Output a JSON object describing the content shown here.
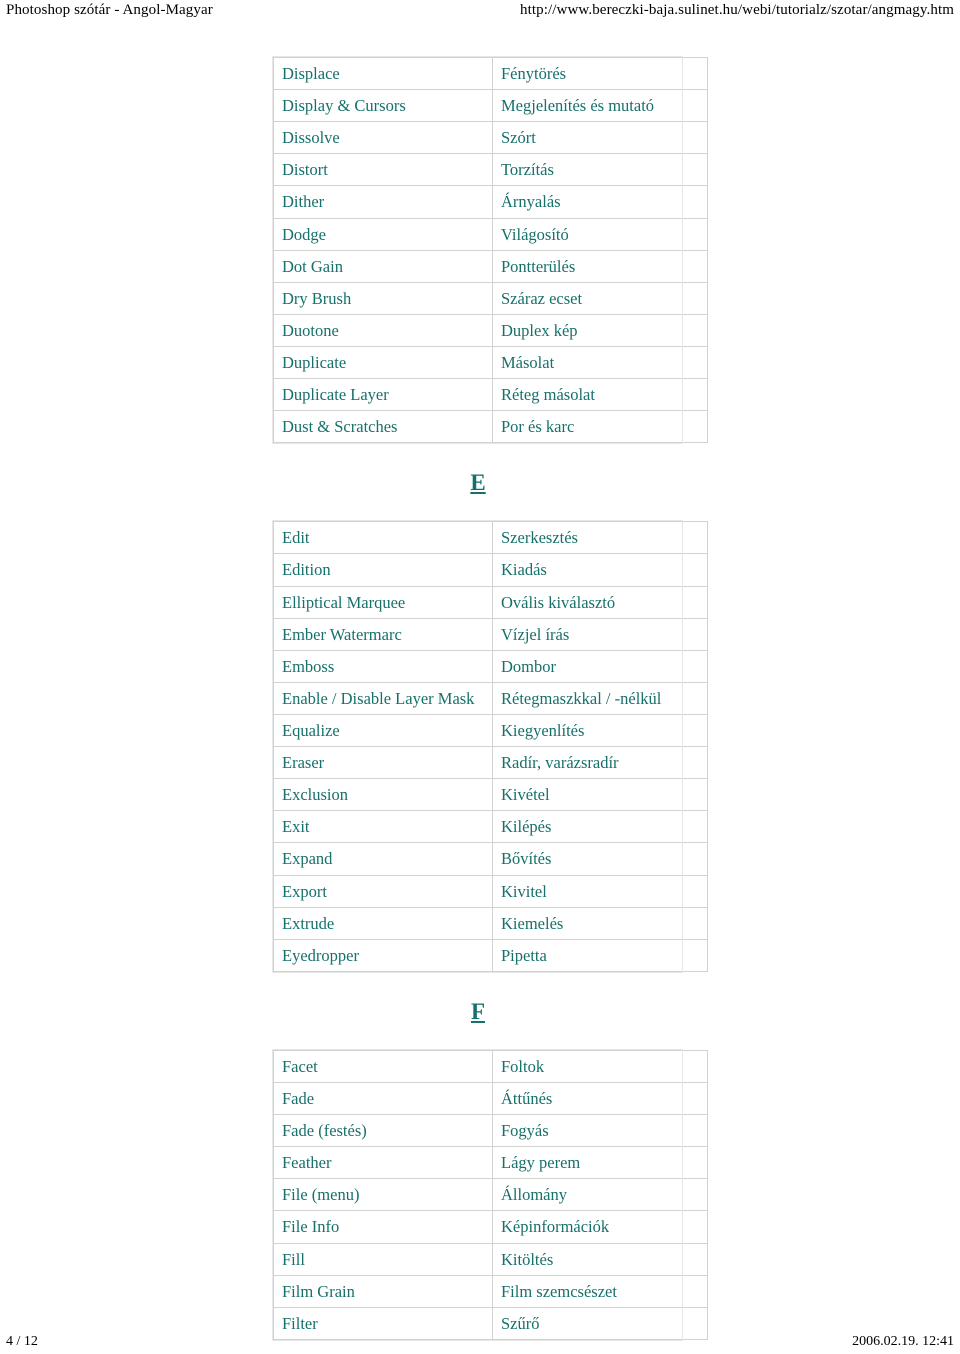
{
  "header": {
    "title": "Photoshop szótár - Angol-Magyar",
    "url": "http://www.bereczki-baja.sulinet.hu/webi/tutorialz/szotar/angmagy.htm"
  },
  "footer": {
    "page_number": "4 / 12",
    "timestamp": "2006.02.19. 12:41"
  },
  "colors": {
    "text_teal": "#16706b",
    "border_gray": "#d2d2d2",
    "page_background": "#ffffff",
    "header_text": "#000000"
  },
  "sections": [
    {
      "letter": "",
      "rows": [
        {
          "en": "Displace",
          "hu": "Fénytörés"
        },
        {
          "en": "Display & Cursors",
          "hu": "Megjelenítés és mutató"
        },
        {
          "en": "Dissolve",
          "hu": "Szórt"
        },
        {
          "en": "Distort",
          "hu": "Torzítás"
        },
        {
          "en": "Dither",
          "hu": "Árnyalás"
        },
        {
          "en": "Dodge",
          "hu": "Világosító"
        },
        {
          "en": "Dot Gain",
          "hu": "Pontterülés"
        },
        {
          "en": "Dry Brush",
          "hu": "Száraz ecset"
        },
        {
          "en": "Duotone",
          "hu": "Duplex kép"
        },
        {
          "en": "Duplicate",
          "hu": "Másolat"
        },
        {
          "en": "Duplicate Layer",
          "hu": "Réteg másolat"
        },
        {
          "en": "Dust & Scratches",
          "hu": "Por és karc"
        }
      ]
    },
    {
      "letter": "E",
      "rows": [
        {
          "en": "Edit",
          "hu": "Szerkesztés"
        },
        {
          "en": "Edition",
          "hu": "Kiadás"
        },
        {
          "en": "Elliptical Marquee",
          "hu": "Ovális kiválasztó"
        },
        {
          "en": "Ember Watermarc",
          "hu": "Vízjel írás"
        },
        {
          "en": "Emboss",
          "hu": "Dombor"
        },
        {
          "en": "Enable / Disable Layer Mask",
          "hu": "Rétegmaszkkal / -nélkül"
        },
        {
          "en": "Equalize",
          "hu": "Kiegyenlítés"
        },
        {
          "en": "Eraser",
          "hu": "Radír, varázsradír"
        },
        {
          "en": "Exclusion",
          "hu": "Kivétel"
        },
        {
          "en": "Exit",
          "hu": "Kilépés"
        },
        {
          "en": "Expand",
          "hu": "Bővítés"
        },
        {
          "en": "Export",
          "hu": "Kivitel"
        },
        {
          "en": "Extrude",
          "hu": "Kiemelés"
        },
        {
          "en": "Eyedropper",
          "hu": "Pipetta"
        }
      ]
    },
    {
      "letter": "F",
      "rows": [
        {
          "en": "Facet",
          "hu": "Foltok"
        },
        {
          "en": "Fade",
          "hu": "Áttűnés"
        },
        {
          "en": "Fade (festés)",
          "hu": "Fogyás"
        },
        {
          "en": "Feather",
          "hu": "Lágy perem"
        },
        {
          "en": "File (menu)",
          "hu": "Állomány"
        },
        {
          "en": "File Info",
          "hu": "Képinformációk"
        },
        {
          "en": "Fill",
          "hu": "Kitöltés"
        },
        {
          "en": "Film Grain",
          "hu": "Film szemcsészet"
        },
        {
          "en": "Filter",
          "hu": "Szűrő"
        }
      ]
    }
  ]
}
